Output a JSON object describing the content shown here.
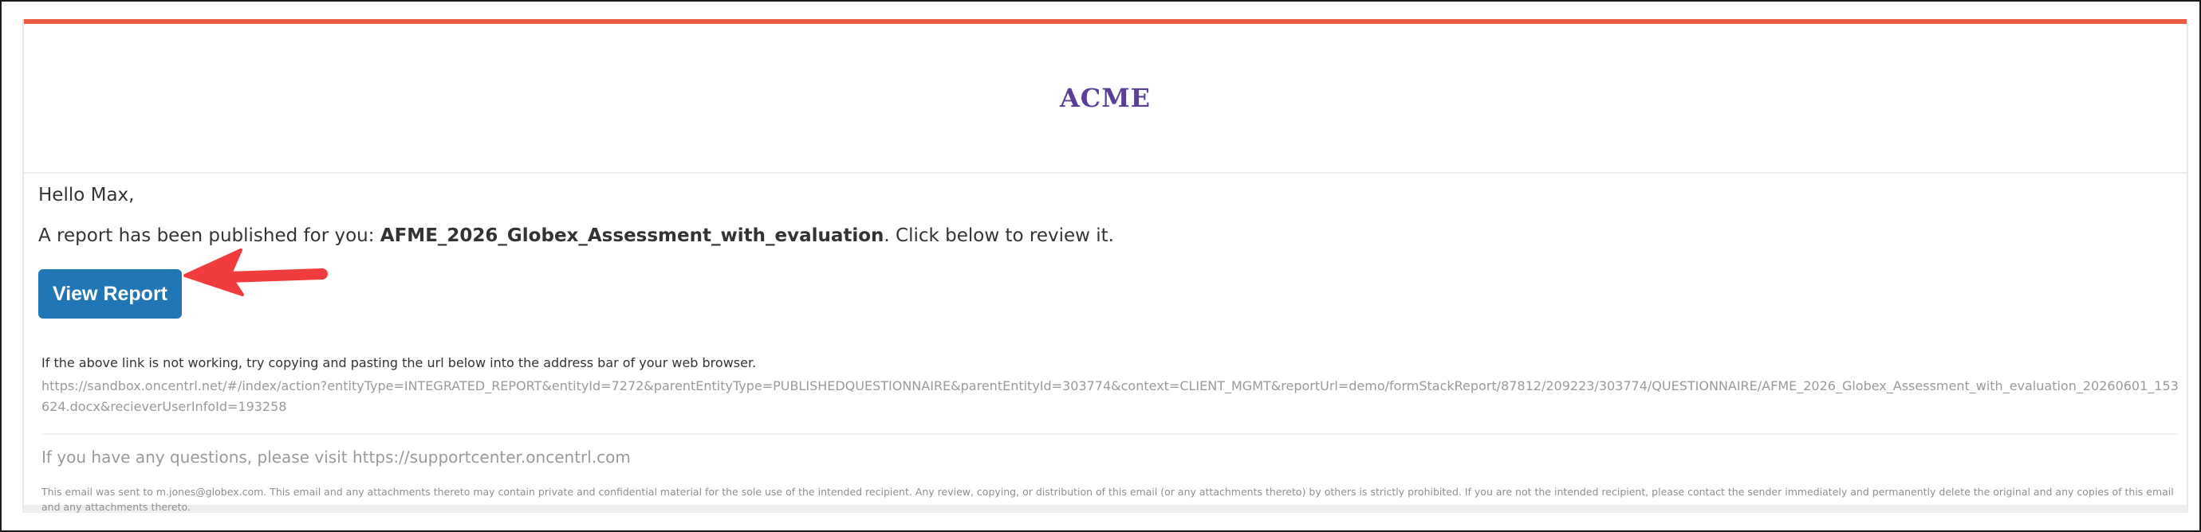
{
  "brand": {
    "logo_text": "ACME",
    "accent_color": "#ef5a45",
    "logo_color": "#5b3f97",
    "button_color": "#2176b5",
    "arrow_color": "#f03c3c"
  },
  "email": {
    "greeting": "Hello Max,",
    "message_prefix": "A report has been published for you: ",
    "report_name": "AFME_2026_Globex_Assessment_with_evaluation",
    "message_suffix": ". Click below to review it.",
    "view_button_label": "View Report",
    "link_hint": "If the above link is not working, try copying and pasting the url below into the address bar of your web browser.",
    "link_url": "https://sandbox.oncentrl.net/#/index/action?entityType=INTEGRATED_REPORT&entityId=7272&parentEntityType=PUBLISHEDQUESTIONNAIRE&parentEntityId=303774&context=CLIENT_MGMT&reportUrl=demo/formStackReport/87812/209223/303774/QUESTIONNAIRE/AFME_2026_Globex_Assessment_with_evaluation_20260601_153624.docx&recieverUserInfoId=193258",
    "questions_text": "If you have any questions, please visit https://supportcenter.oncentrl.com",
    "disclaimer": "This email was sent to m.jones@globex.com. This email and any attachments thereto may contain private and confidential material for the sole use of the intended recipient. Any review, copying, or distribution of this email (or any attachments thereto) by others is strictly prohibited. If you are not the intended recipient, please contact the sender immediately and permanently delete the original and any copies of this email and any attachments thereto."
  },
  "annotations": {
    "arrow_icon": "red-arrow-pointing-left-icon"
  }
}
